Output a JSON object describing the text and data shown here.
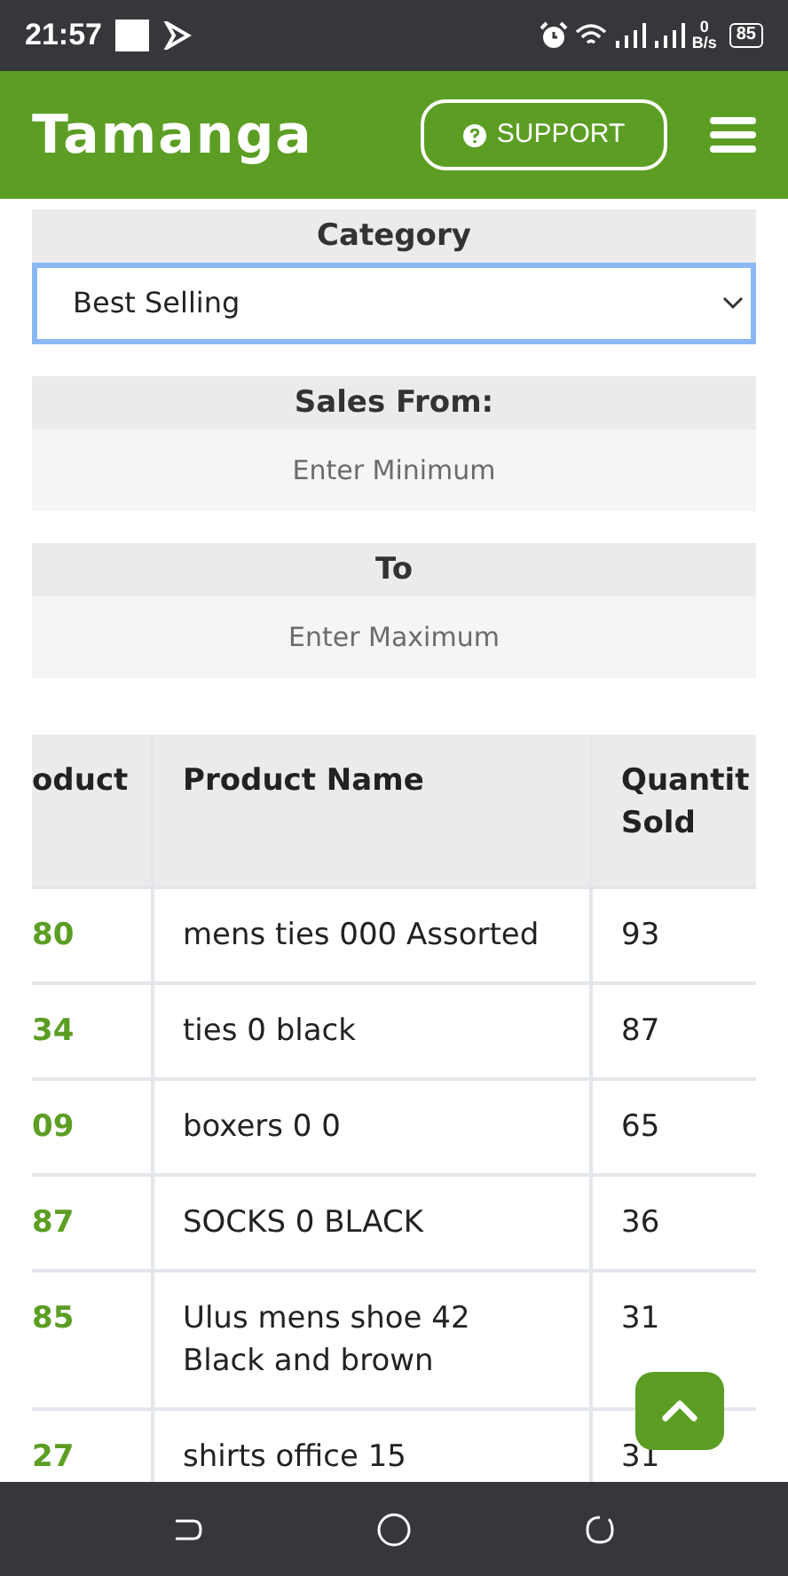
{
  "status_bar": {
    "time": "21:57",
    "net_speed_value": "0",
    "net_speed_unit": "B/s",
    "battery": "85"
  },
  "header": {
    "brand": "Tamanga",
    "support_button": "SUPPORT"
  },
  "filters": {
    "category": {
      "label": "Category",
      "value": "Best Selling"
    },
    "sales_from": {
      "label": "Sales From:",
      "placeholder": "Enter Minimum"
    },
    "to": {
      "label": "To",
      "placeholder": "Enter Maximum"
    }
  },
  "table": {
    "columns": [
      "oduct",
      "Product Name",
      "Quantit Sold"
    ],
    "rows": [
      {
        "column_1": "80",
        "product_name": "mens ties 000 Assorted",
        "quantity_sold": "93"
      },
      {
        "column_1": "34",
        "product_name": "ties 0 black",
        "quantity_sold": "87"
      },
      {
        "column_1": "09",
        "product_name": "boxers 0 0",
        "quantity_sold": "65"
      },
      {
        "column_1": "87",
        "product_name": "SOCKS 0 BLACK",
        "quantity_sold": "36"
      },
      {
        "column_1": "85",
        "product_name": "Ulus mens shoe 42 Black and brown",
        "quantity_sold": "31"
      },
      {
        "column_1": "27",
        "product_name": "shirts office 15",
        "quantity_sold": "31"
      }
    ]
  }
}
